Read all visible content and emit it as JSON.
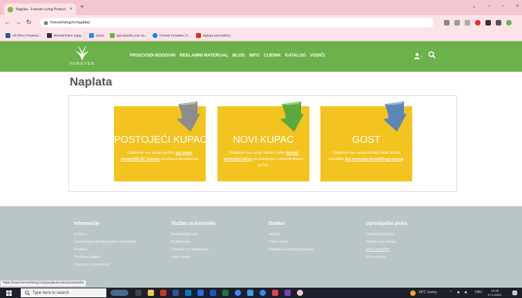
{
  "browser": {
    "tab_title": "Naplata - Forever Living Product",
    "tab_close": "×",
    "new_tab": "+",
    "url": "foreverliving.hr/naplata/",
    "bookmarks": [
      {
        "label": "All Files | Powered...",
        "color": "#2b579a"
      },
      {
        "label": "Wondershare Supp...",
        "color": "#333333"
      },
      {
        "label": "Zoom",
        "color": "#2d8cff"
      },
      {
        "label": "Igra Bandit Ludo na...",
        "color": "#6cb14a"
      },
      {
        "label": "Forever Hrvatska | F...",
        "color": "#1877f2"
      },
      {
        "label": "laptops and netboo...",
        "color": "#d93025"
      }
    ]
  },
  "site": {
    "logo_text": "FOREVER",
    "nav": [
      "PROIZVODI-BODOVNI",
      "REKLAMNI MATERIJAL",
      "BLOG",
      "INFO",
      "CIJENIK",
      "KATALOG",
      "VODIČI"
    ],
    "user_icon": "user-icon",
    "search_icon": "search-icon",
    "brand_green": "#6cb14a",
    "accent_yellow": "#f3c320"
  },
  "page": {
    "title": "Naplata",
    "cards": [
      {
        "title": "POSTOJEĆI KUPAC",
        "desc_before": "Odaberite ovu opciju ukoliko ",
        "desc_bold": "već imate suradnički ID i lozinku",
        "desc_after": " za prijavu na webshop.",
        "arrow_color": "#8d8d8d"
      },
      {
        "title": "NOVI KUPAC",
        "desc_before": "Odaberite ovu opciju ukoliko želite ",
        "desc_bold": "kreirati korisnički račun",
        "desc_after": " na webshopu i ostvariti popust od 5%.",
        "arrow_color": "#5aa83f"
      },
      {
        "title": "GOST",
        "desc_before": "Odaberite ovu opciju ukoliko želite izvršiti narudžbu ",
        "desc_bold": "bez kreiranja korisničkog računa",
        "desc_after": ".",
        "arrow_color": "#5c86b8"
      }
    ]
  },
  "footer": {
    "columns": [
      {
        "heading": "Informacije",
        "links": [
          "O nama",
          "Uvjeti kupnje (predugovorne obavijesti)",
          "Dostava",
          "Poslovna politika",
          "Obavijest o privatnosti"
        ]
      },
      {
        "heading": "Služba za korisnike",
        "links": [
          "Kontaktirajte nas",
          "Reklamacije",
          "Obrazac za reklamaciju",
          "Video upute"
        ]
      },
      {
        "heading": "Dodaci",
        "links": [
          "eKnjine",
          "Video upute",
          "Gradnja vlastitog poslovanja"
        ]
      },
      {
        "heading": "Upravljačka ploča",
        "links": [
          "Upravljačka ploča",
          "Detalji mog računa",
          "Moje narudžbe",
          "Moje adrese"
        ]
      }
    ],
    "status_url": "https://www.foreverliving.hr/upravljacka-ploca/narudzbe"
  },
  "taskbar": {
    "search_placeholder": "Type here to search",
    "weather": "18°C Sunny",
    "language": "HRV",
    "time": "12:36",
    "date": "17.4.2022."
  }
}
